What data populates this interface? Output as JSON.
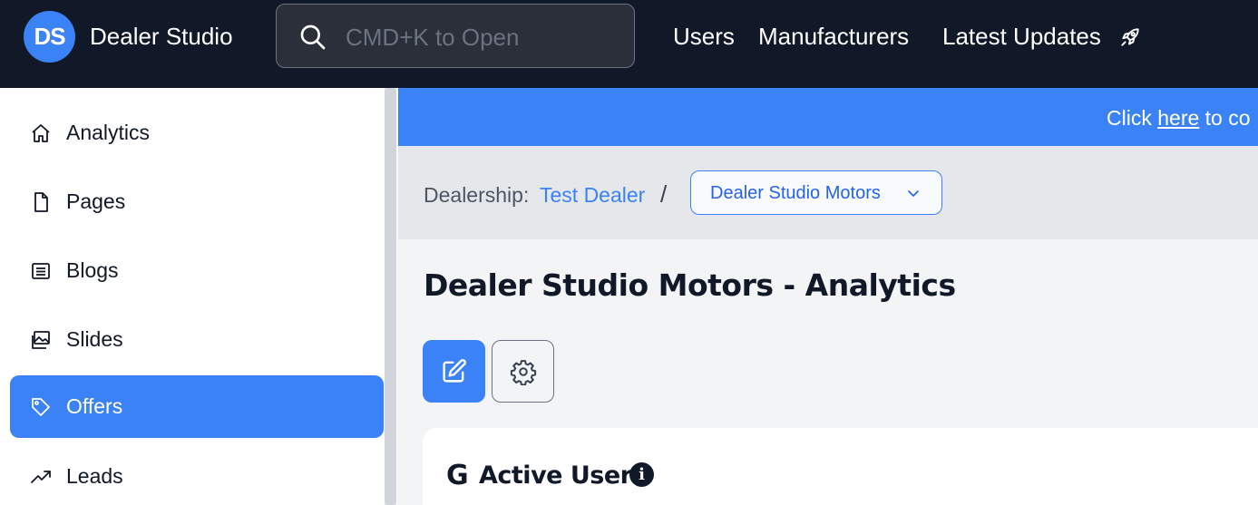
{
  "app": {
    "logo_text": "DS",
    "brand_name": "Dealer Studio"
  },
  "search": {
    "placeholder": "CMD+K to Open",
    "icon": "search-icon"
  },
  "topnav": {
    "users": "Users",
    "manufacturers": "Manufacturers",
    "latest_updates": "Latest Updates",
    "latest_updates_icon": "rocket-icon"
  },
  "sidebar": {
    "items": [
      {
        "label": "Analytics",
        "icon": "home-icon",
        "active": false
      },
      {
        "label": "Pages",
        "icon": "document-icon",
        "active": false
      },
      {
        "label": "Blogs",
        "icon": "newspaper-icon",
        "active": false
      },
      {
        "label": "Slides",
        "icon": "images-icon",
        "active": false
      },
      {
        "label": "Offers",
        "icon": "tag-icon",
        "active": true
      },
      {
        "label": "Leads",
        "icon": "trending-up-icon",
        "active": false
      }
    ]
  },
  "banner": {
    "prefix": "Click ",
    "link": "here",
    "suffix": " to co"
  },
  "breadcrumb": {
    "label": "Dealership:",
    "dealer_link": "Test Dealer",
    "separator": "/",
    "selected_site": "Dealer Studio Motors"
  },
  "main": {
    "page_title": "Dealer Studio Motors - Analytics",
    "card_title": "Active Users",
    "card_source_glyph": "G",
    "info_glyph": "i"
  },
  "colors": {
    "topbar": "#111827",
    "accent": "#3b82f6",
    "sidebar_bg": "#ffffff",
    "main_bg": "#f3f4f6"
  }
}
